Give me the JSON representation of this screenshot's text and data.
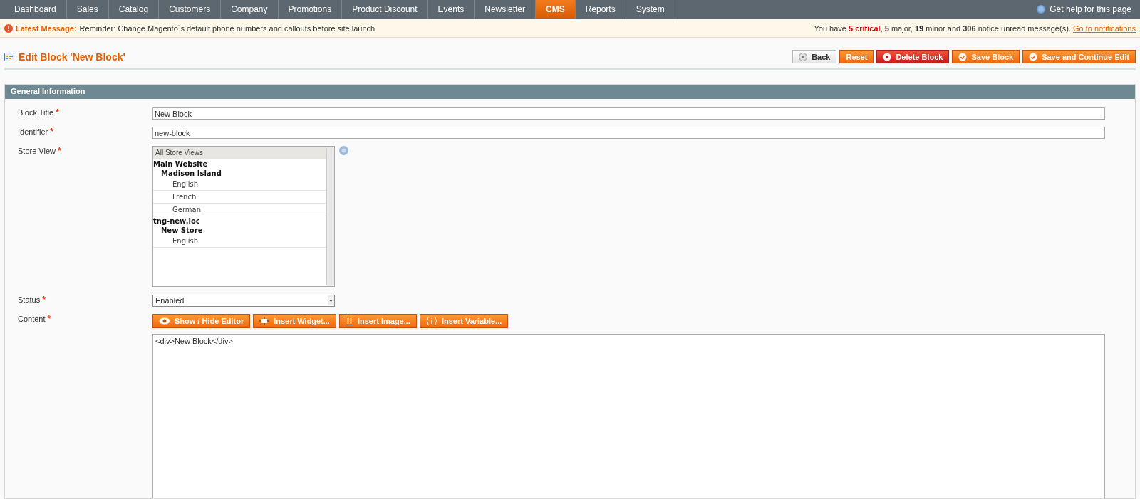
{
  "nav": {
    "items": [
      {
        "label": "Dashboard",
        "selected": false
      },
      {
        "label": "Sales",
        "selected": false
      },
      {
        "label": "Catalog",
        "selected": false
      },
      {
        "label": "Customers",
        "selected": false
      },
      {
        "label": "Company",
        "selected": false
      },
      {
        "label": "Promotions",
        "selected": false
      },
      {
        "label": "Product Discount",
        "selected": false
      },
      {
        "label": "Events",
        "selected": false
      },
      {
        "label": "Newsletter",
        "selected": false
      },
      {
        "label": "CMS",
        "selected": true
      },
      {
        "label": "Reports",
        "selected": false
      },
      {
        "label": "System",
        "selected": false
      }
    ],
    "help": "Get help for this page"
  },
  "message_bar": {
    "label": "Latest Message:",
    "text": "Reminder: Change Magento`s default phone numbers and callouts before site launch",
    "summary": [
      {
        "text": "You have ",
        "kind": "plain"
      },
      {
        "text": "5 critical",
        "kind": "critical"
      },
      {
        "text": ", ",
        "kind": "plain"
      },
      {
        "text": "5",
        "kind": "count"
      },
      {
        "text": " major, ",
        "kind": "plain"
      },
      {
        "text": "19",
        "kind": "count"
      },
      {
        "text": " minor and ",
        "kind": "plain"
      },
      {
        "text": "306",
        "kind": "count"
      },
      {
        "text": " notice unread message(s). ",
        "kind": "plain"
      }
    ],
    "link": "Go to notifications"
  },
  "page_title": "Edit Block 'New Block'",
  "actions": [
    {
      "label": "Back",
      "kind": "back"
    },
    {
      "label": "Reset",
      "kind": "plain"
    },
    {
      "label": "Delete Block",
      "kind": "delete"
    },
    {
      "label": "Save Block",
      "kind": "save"
    },
    {
      "label": "Save and Continue Edit",
      "kind": "save"
    }
  ],
  "section": {
    "title": "General Information",
    "fields": [
      {
        "label": "Block Title",
        "required_mark": "*",
        "kind": "text",
        "value": "New Block"
      },
      {
        "label": "Identifier",
        "required_mark": "*",
        "kind": "text",
        "value": "new-block"
      },
      {
        "label": "Store View",
        "required_mark": "*",
        "kind": "multiselect",
        "options": [
          {
            "label": "All Store Views",
            "kind": "option",
            "selected": true
          },
          {
            "label": "Main Website",
            "kind": "group",
            "children": [
              {
                "label": "Madison Island",
                "kind": "group",
                "children": [
                  {
                    "label": "English",
                    "kind": "option",
                    "selected": false
                  },
                  {
                    "label": "French",
                    "kind": "option",
                    "selected": false
                  },
                  {
                    "label": "German",
                    "kind": "option",
                    "selected": false
                  }
                ]
              }
            ]
          },
          {
            "label": "tng-new.loc",
            "kind": "group",
            "children": [
              {
                "label": "New Store",
                "kind": "group",
                "children": [
                  {
                    "label": "English",
                    "kind": "option",
                    "selected": false
                  }
                ]
              }
            ]
          }
        ]
      },
      {
        "label": "Status",
        "required_mark": "*",
        "kind": "select",
        "value": "Enabled"
      },
      {
        "label": "Content",
        "required_mark": "*",
        "kind": "editor",
        "buttons": [
          {
            "label": "Show / Hide Editor",
            "kind": "eye"
          },
          {
            "label": "Insert Widget...",
            "kind": "widget"
          },
          {
            "label": "Insert Image...",
            "kind": "image"
          },
          {
            "label": "Insert Variable...",
            "kind": "variable"
          }
        ],
        "value": "<div>New Block</div>"
      }
    ]
  }
}
